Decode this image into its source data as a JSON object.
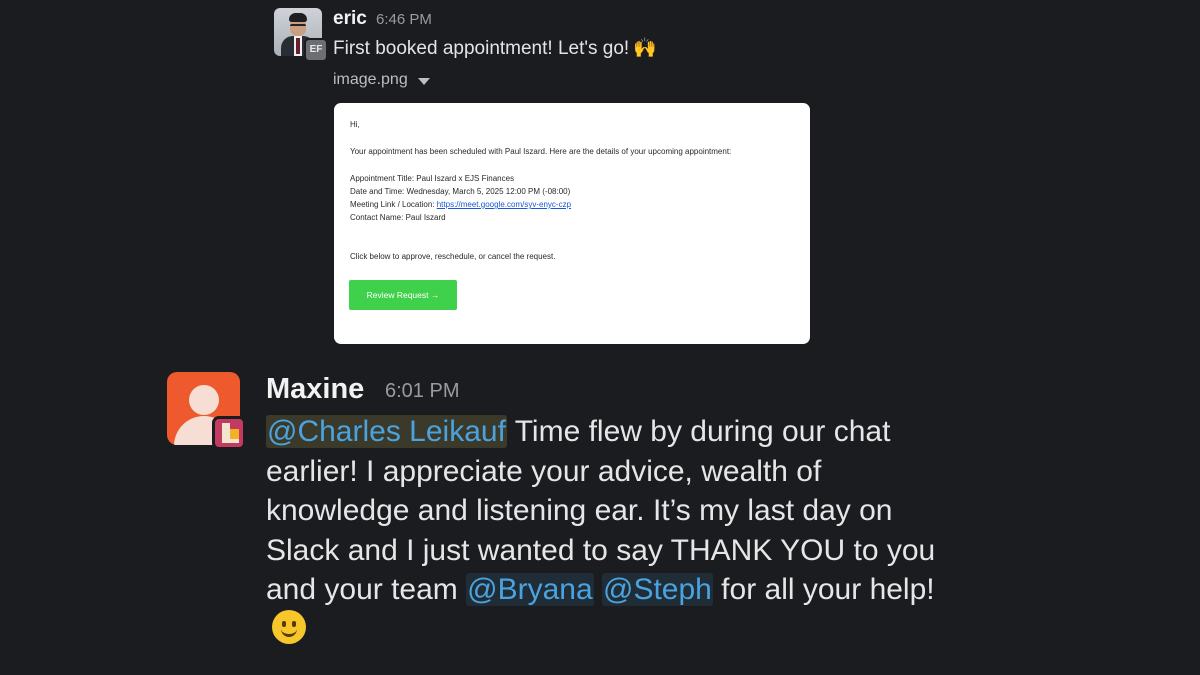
{
  "messages": [
    {
      "sender": "eric",
      "badge": "EF",
      "time": "6:46 PM",
      "text": "First booked appointment! Let's go!",
      "emoji": "🙌",
      "attachment": {
        "filename": "image.png",
        "email": {
          "greeting": "Hi,",
          "intro": "Your appointment has been scheduled with Paul Iszard. Here are the details of your upcoming appointment:",
          "title_line": "Appointment Title: Paul Iszard x EJS Finances",
          "datetime_line": "Date and Time: Wednesday, March 5, 2025 12:00 PM (-08:00)",
          "link_label": "Meeting Link / Location:",
          "link_url": "https://meet.google.com/syv-enyc-czp",
          "contact_line": "Contact Name: Paul Iszard",
          "cta_text": "Click below to approve, reschedule, or cancel the request.",
          "button_label": "Review Request →"
        }
      }
    },
    {
      "sender": "Maxine",
      "time": "6:01 PM",
      "mention1": "@Charles Leikauf",
      "text1": " Time flew by during our chat earlier! I appreciate your advice, wealth of knowledge and listening ear. It’s my last day on Slack and I just wanted to say THANK YOU to you and your team ",
      "mention2": "@Bryana",
      "mention3": "@Steph",
      "text2": " for all your help!",
      "emoji": "slightly-smiling-face"
    }
  ],
  "colors": {
    "background": "#1b1c1f",
    "mention": "#4aa3de",
    "button_green": "#3fd14b",
    "maxine_avatar": "#ee5a2d"
  }
}
